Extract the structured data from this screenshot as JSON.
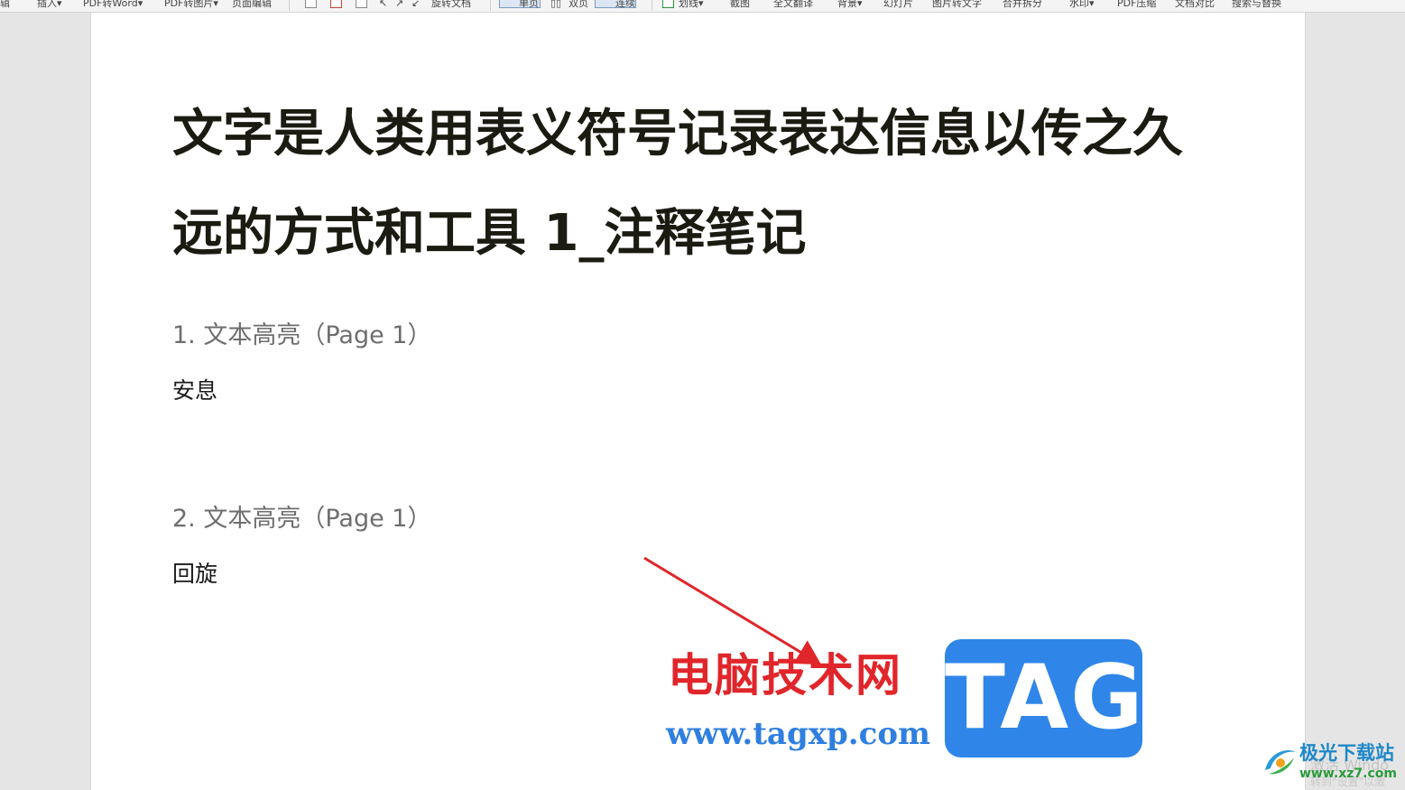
{
  "toolbar": {
    "items": {
      "edit_tail": "辑",
      "insert": "插入▾",
      "pdf_to_word": "PDF转Word▾",
      "pdf_to_image": "PDF转图片▾",
      "page_edit": "页面编辑",
      "rotate_doc": "旋转文档",
      "single_page": "单页",
      "double_page": "双页",
      "continuous": "连续",
      "draw_line": "划线▾",
      "screenshot": "截图",
      "full_translate": "全文翻译",
      "background": "背景▾",
      "slideshow": "幻灯片",
      "image_to_text": "图片转文字",
      "merge_split": "合并拆分",
      "watermark": "水印▾",
      "pdf_compress": "PDF压缩",
      "doc_compare": "文档对比",
      "search_replace": "搜索与替换"
    }
  },
  "document": {
    "title": "文字是人类用表义符号记录表达信息以传之久远的方式和工具 1_注释笔记",
    "notes": [
      {
        "heading": "1. 文本高亮（Page 1）",
        "body": "安息"
      },
      {
        "heading": "2. 文本高亮（Page 1）",
        "body": "回旋"
      }
    ]
  },
  "watermark": {
    "site_name": "电脑技术网",
    "site_url": "www.tagxp.com",
    "tag": "TAG",
    "corner_logo_name": "极光下载站",
    "corner_logo_url": "www.xz7.com",
    "activate_text_1": "激活 Windo",
    "activate_text_2": "转到\"设置\"以激"
  },
  "colors": {
    "annotation_arrow": "#e0262b",
    "watermark_red": "#e0262b",
    "watermark_blue": "#2f86e8"
  }
}
